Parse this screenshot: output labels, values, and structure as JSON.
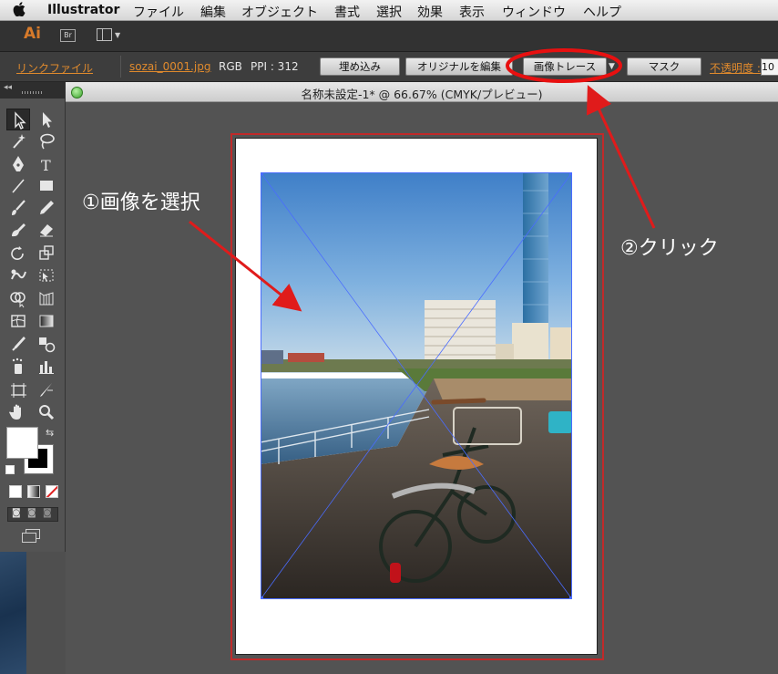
{
  "menubar": {
    "app_name": "Illustrator",
    "items": [
      "ファイル",
      "編集",
      "オブジェクト",
      "書式",
      "選択",
      "効果",
      "表示",
      "ウィンドウ",
      "ヘルプ"
    ]
  },
  "appbar": {
    "logo": "Ai",
    "bridge": "Br"
  },
  "control_bar": {
    "link_file": "リンクファイル",
    "filename": "sozai_0001.jpg",
    "color_mode": "RGB",
    "ppi": "PPI : 312",
    "embed_button": "埋め込み",
    "edit_original_button": "オリジナルを編集",
    "image_trace_button": "画像トレース",
    "mask_button": "マスク",
    "opacity_label": "不透明度 :",
    "opacity_value": "10"
  },
  "document": {
    "tab_title": "名称未設定-1* @ 66.67% (CMYK/プレビュー)"
  },
  "annotations": {
    "step1": "①画像を選択",
    "step2": "②クリック",
    "color": "#e01b1b"
  },
  "tools": [
    "selection-tool",
    "direct-selection-tool",
    "magic-wand-tool",
    "lasso-tool",
    "pen-tool",
    "type-tool",
    "line-tool",
    "rectangle-tool",
    "paintbrush-tool",
    "pencil-tool",
    "blob-brush-tool",
    "eraser-tool",
    "rotate-tool",
    "scale-tool",
    "warp-tool",
    "free-transform-tool",
    "shape-builder-tool",
    "perspective-grid-tool",
    "mesh-tool",
    "gradient-tool",
    "eyedropper-tool",
    "blend-tool",
    "symbol-sprayer-tool",
    "column-graph-tool",
    "artboard-tool",
    "slice-tool",
    "hand-tool",
    "zoom-tool"
  ]
}
